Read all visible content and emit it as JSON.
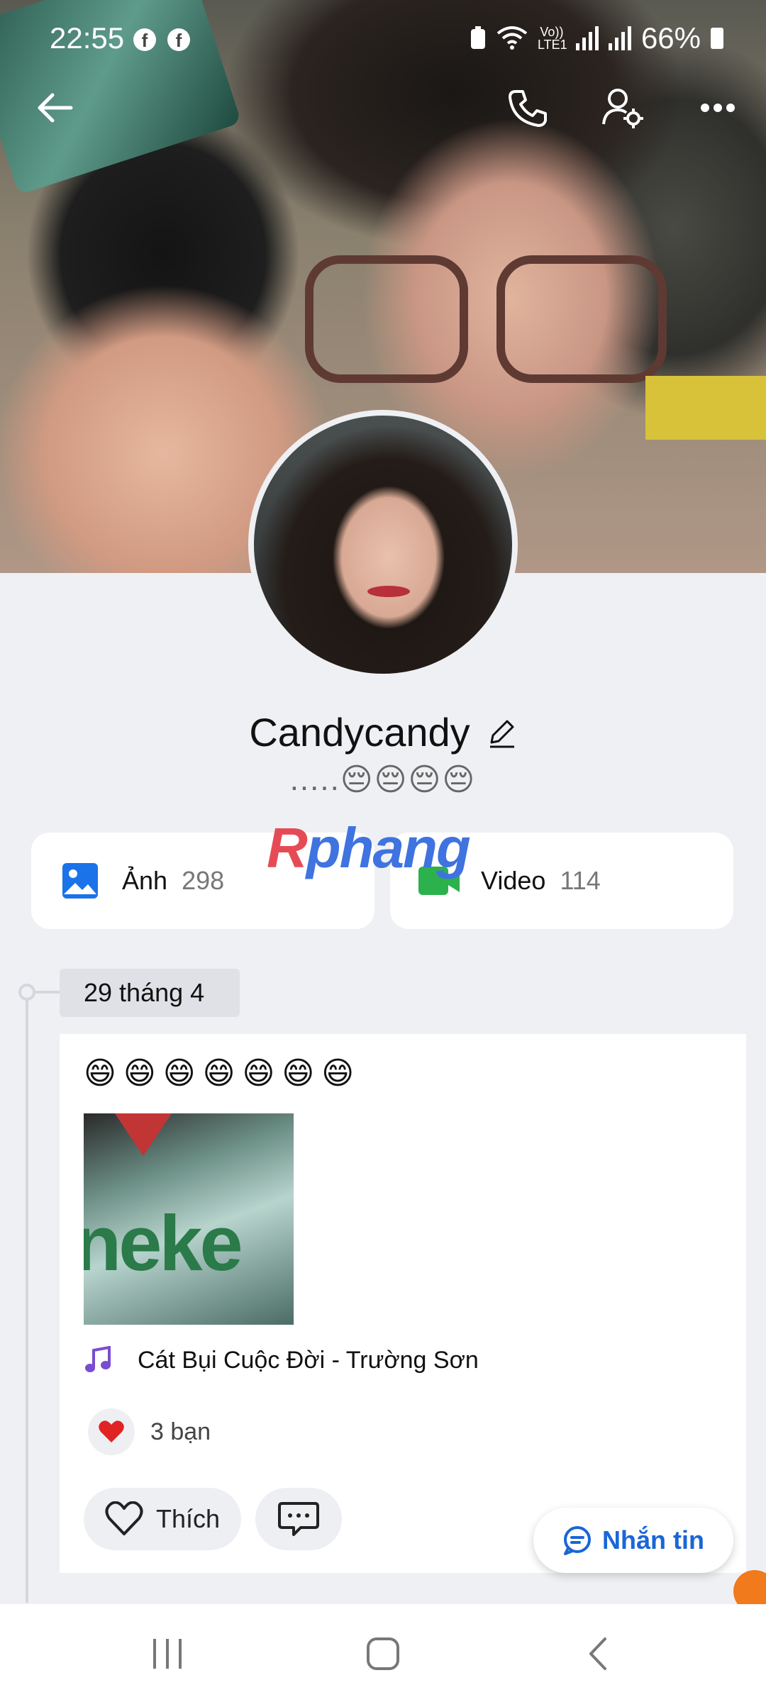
{
  "status_bar": {
    "time": "22:55",
    "network_label": "Vo)) LTE1",
    "battery": "66%"
  },
  "profile": {
    "name": "Candycandy",
    "status": ".....😔😔😔😔"
  },
  "media": {
    "photos_label": "Ảnh",
    "photos_count": "298",
    "videos_label": "Video",
    "videos_count": "114"
  },
  "watermark": {
    "part1": "R",
    "part2": "phang"
  },
  "timeline": {
    "date": "29 tháng 4",
    "post": {
      "text": "😄😄😄😄😄😄😄",
      "image_text": "neke",
      "music": "Cát Bụi Cuộc Đời - Trường Sơn",
      "likes": "3 bạn",
      "like_button": "Thích"
    }
  },
  "message_button": "Nhắn tin",
  "colors": {
    "accent": "#1a66d6",
    "video_green": "#2bb24c",
    "photo_blue": "#1a73e8",
    "music_purple": "#7a4ccf",
    "heart_red": "#e02424"
  }
}
